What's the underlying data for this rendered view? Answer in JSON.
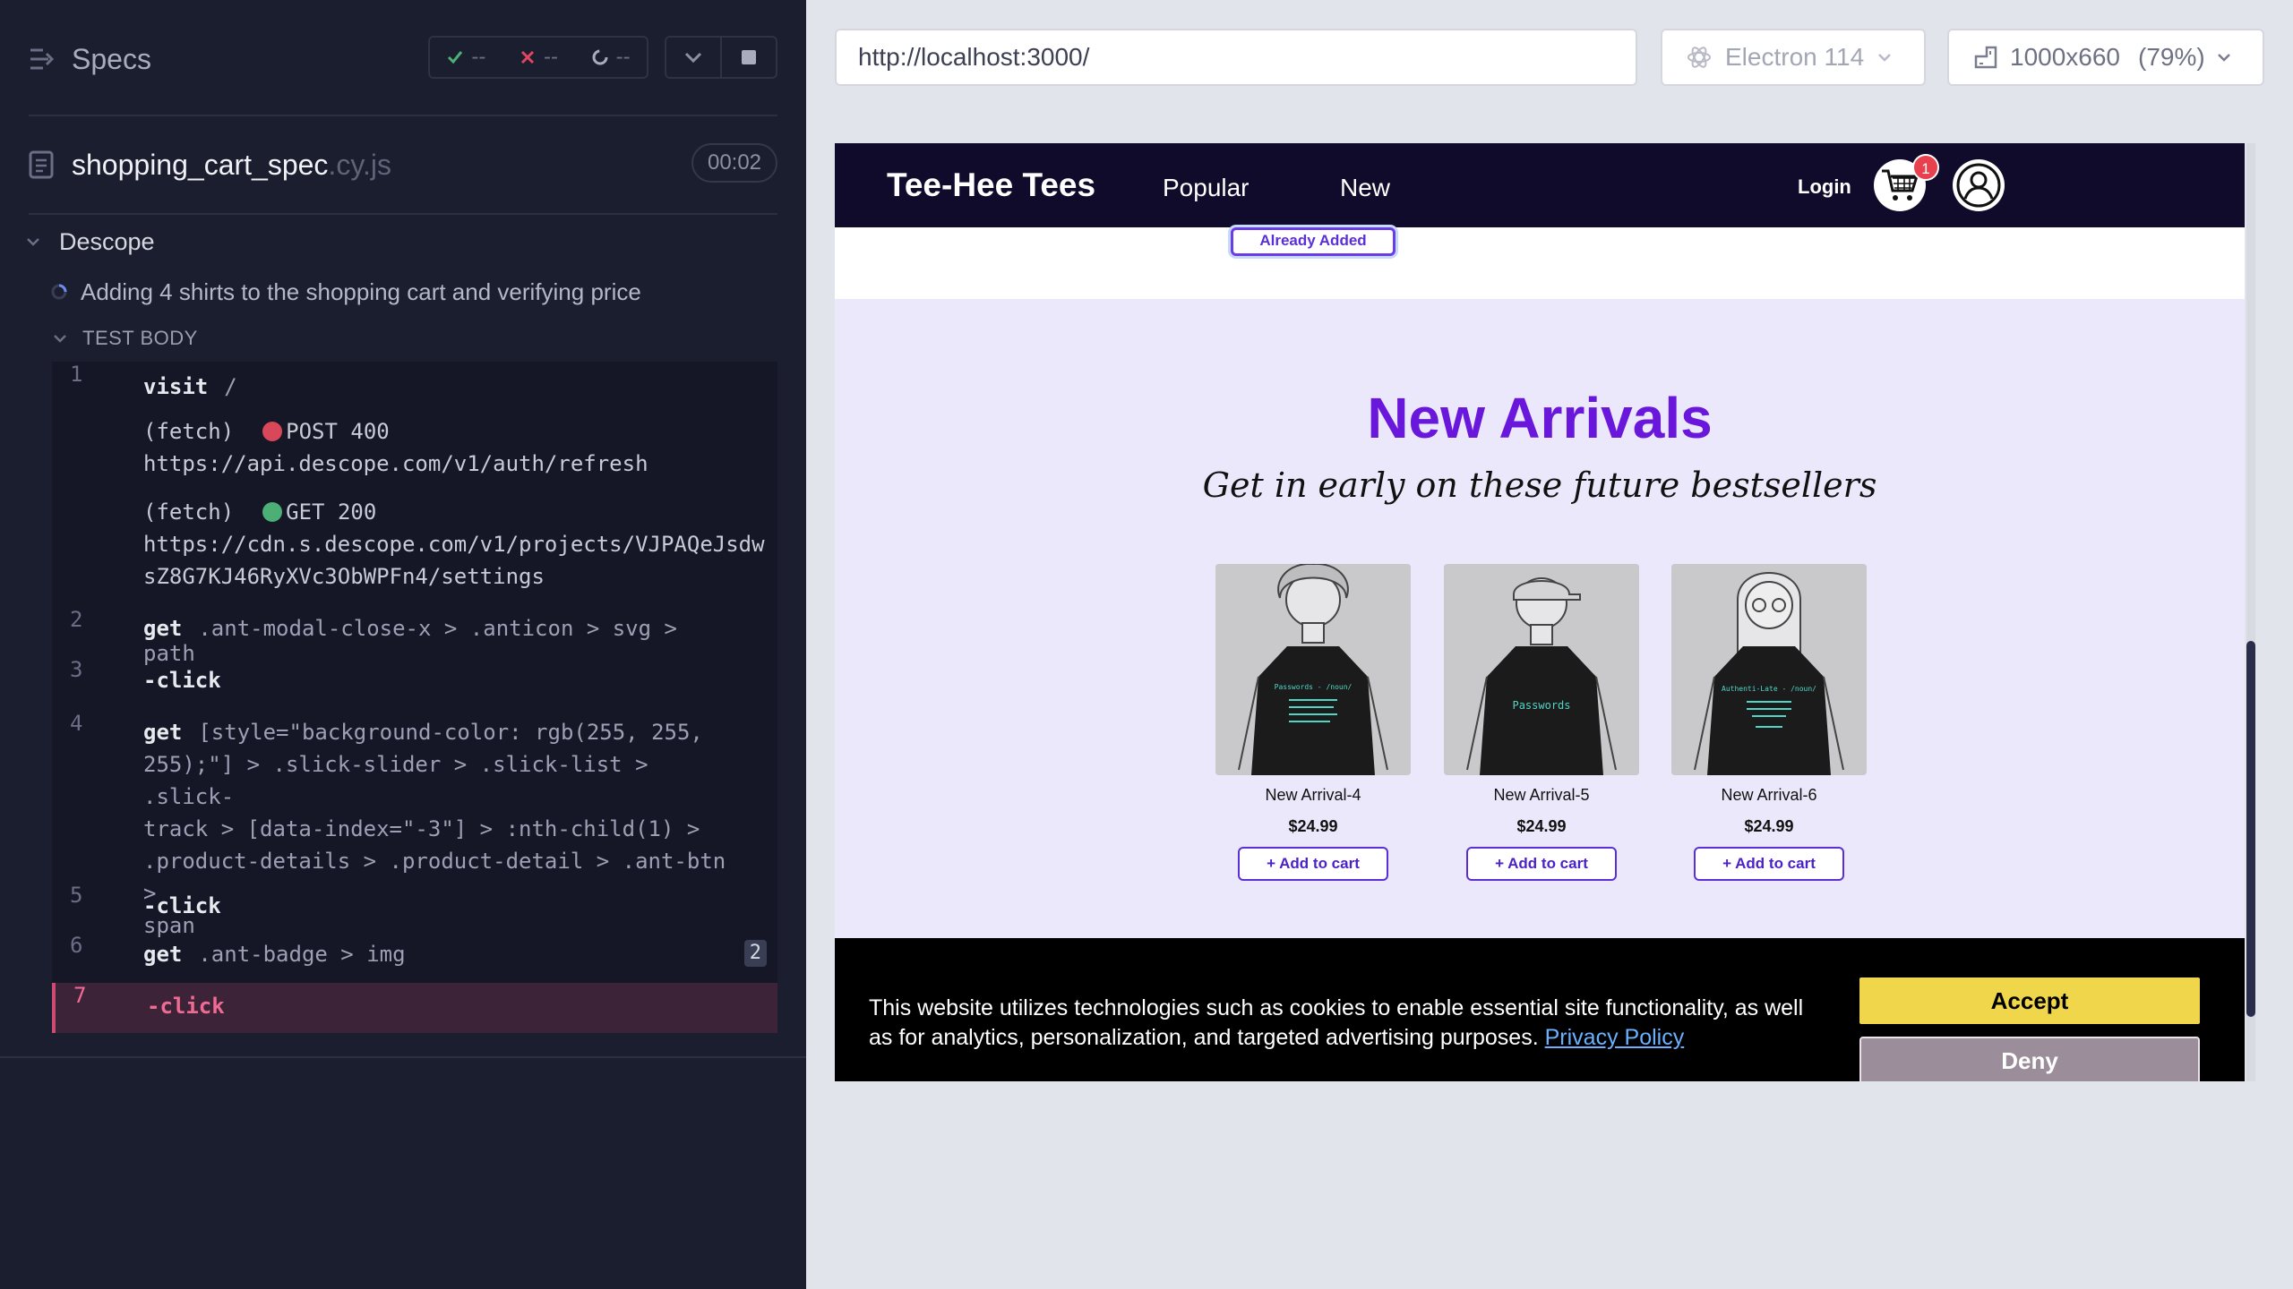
{
  "runner": {
    "specs_label": "Specs",
    "stats": {
      "passed": "--",
      "failed": "--",
      "pending": "--"
    },
    "file": {
      "name": "shopping_cart_spec",
      "ext": ".cy.js",
      "timer": "00:02"
    },
    "suite": "Descope",
    "test": "Adding 4 shirts to the shopping cart and verifying price",
    "test_body_label": "TEST BODY",
    "commands": [
      {
        "num": "1",
        "name": "visit",
        "arg": "/"
      },
      {
        "type": "(fetch)",
        "method": "POST 400",
        "url": "https://api.descope.com/v1/auth/refresh",
        "status_color": "#d9475b"
      },
      {
        "type": "(fetch)",
        "method": "GET 200",
        "url_line1": "https://cdn.s.descope.com/v1/projects/VJPAQeJsdw",
        "url_line2": "sZ8G7KJ46RyXVc3ObWPFn4/settings",
        "status_color": "#4caf76"
      },
      {
        "num": "2",
        "name": "get",
        "arg": ".ant-modal-close-x > .anticon > svg > path"
      },
      {
        "num": "3",
        "name": "-click",
        "arg": ""
      },
      {
        "num": "4",
        "name": "get",
        "arg_line1": "[style=\"background-color: rgb(255, 255,",
        "arg_line2": "255);\"] > .slick-slider > .slick-list > .slick-",
        "arg_line3": "track > [data-index=\"-3\"] > :nth-child(1) >",
        "arg_line4": ".product-details > .product-detail > .ant-btn >",
        "arg_line5": "span"
      },
      {
        "num": "5",
        "name": "-click",
        "arg": ""
      },
      {
        "num": "6",
        "name": "get",
        "arg": ".ant-badge > img",
        "badge": "2"
      },
      {
        "num": "7",
        "name": "-click",
        "arg": ""
      }
    ]
  },
  "browser_bar": {
    "url": "http://localhost:3000/",
    "browser": "Electron 114",
    "viewport": "1000x660",
    "scale": "(79%)"
  },
  "app": {
    "brand": "Tee-Hee Tees",
    "nav": {
      "popular": "Popular",
      "new": "New",
      "login": "Login"
    },
    "cart_count": "1",
    "already_added": "Already Added",
    "section": {
      "title": "New Arrivals",
      "subtitle": "Get in early on these future bestsellers"
    },
    "products": [
      {
        "name": "New Arrival-4",
        "price": "$24.99",
        "button": "+ Add to cart",
        "shirt_title": "Passwords - /noun/",
        "shirt_color": "#1b1b1b",
        "text_color": "#4fd6c6"
      },
      {
        "name": "New Arrival-5",
        "price": "$24.99",
        "button": "+ Add to cart",
        "shirt_title": "Passwords",
        "shirt_color": "#1b1b1b",
        "text_color": "#4fd6c6"
      },
      {
        "name": "New Arrival-6",
        "price": "$24.99",
        "button": "+ Add to cart",
        "shirt_title": "Authenti-Late - /noun/",
        "shirt_color": "#1b1b1b",
        "text_color": "#4fd6c6"
      }
    ],
    "cookie": {
      "text": "This website utilizes technologies such as cookies to enable essential site functionality, as well as for analytics, personalization, and targeted advertising purposes.",
      "link": "Privacy Policy",
      "accept": "Accept",
      "deny": "Deny"
    }
  }
}
